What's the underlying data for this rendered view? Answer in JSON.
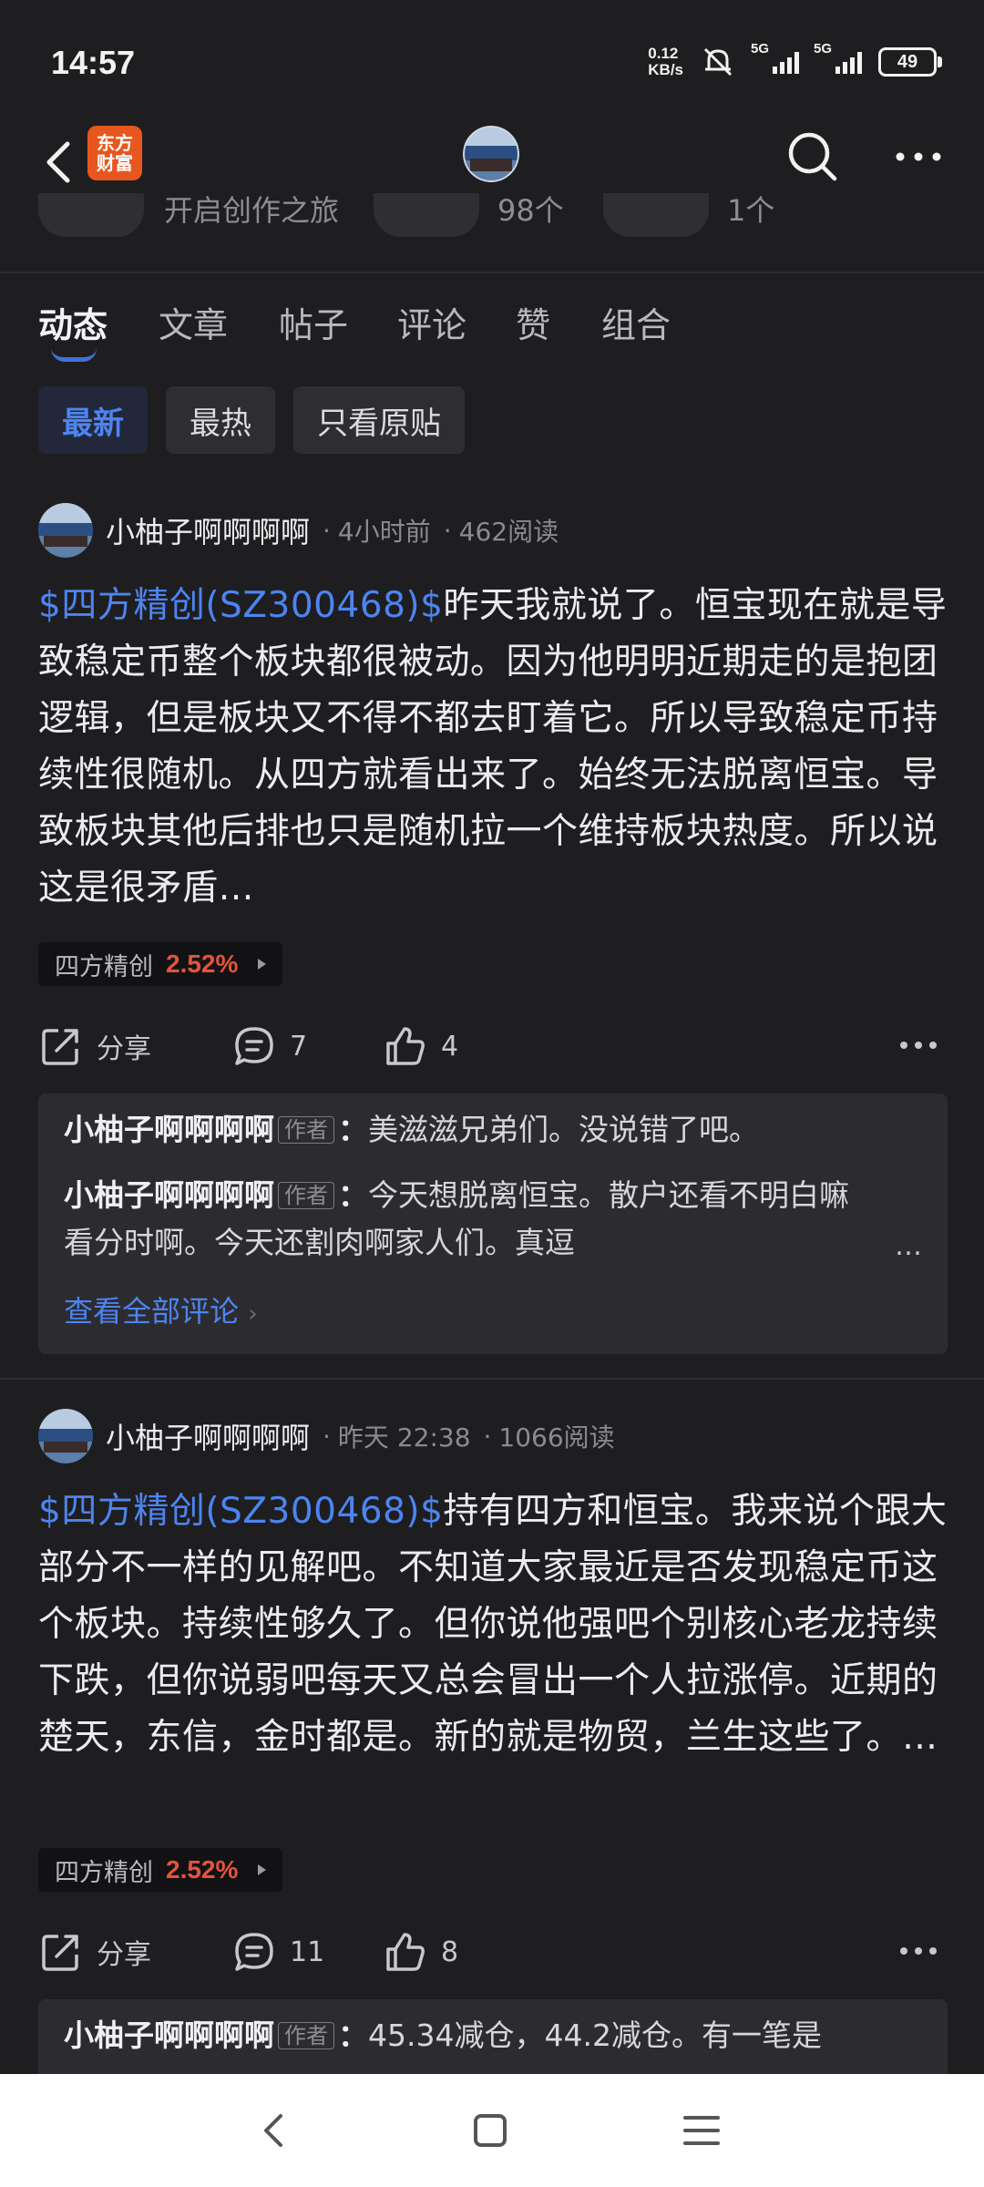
{
  "status_bar": {
    "time": "14:57",
    "net_speed_value": "0.12",
    "net_speed_unit": "KB/s",
    "sim1": "5G",
    "sim2": "5G",
    "battery": "49"
  },
  "header": {
    "logo_line1": "东方",
    "logo_line2": "财富"
  },
  "profile_stats": {
    "item1": "开启创作之旅",
    "item2": "98个",
    "item3": "1个"
  },
  "tabs": [
    "动态",
    "文章",
    "帖子",
    "评论",
    "赞",
    "组合"
  ],
  "filters": [
    "最新",
    "最热",
    "只看原贴"
  ],
  "posts": [
    {
      "author": "小柚子啊啊啊啊",
      "time": "4小时前",
      "reads": "462阅读",
      "stock_link": "$四方精创(SZ300468)$",
      "text": "昨天我就说了。恒宝现在就是导致稳定币整个板块都很被动。因为他明明近期走的是抱团逻辑，但是板块又不得不都去盯着它。所以导致稳定币持续性很随机。从四方就看出来了。始终无法脱离恒宝。导致板块其他后排也只是随机拉一个维持板块热度。所以说这是很矛盾…",
      "tag_name": "四方精创",
      "tag_pct": "2.52%",
      "share": "分享",
      "comment_count": "7",
      "like_count": "4",
      "comments": [
        {
          "author": "小柚子啊啊啊啊",
          "badge": "作者",
          "sep": "：",
          "text": "美滋滋兄弟们。没说错了吧。"
        },
        {
          "author": "小柚子啊啊啊啊",
          "badge": "作者",
          "sep": "：",
          "text": "今天想脱离恒宝。散户还看不明白嘛看分时啊。今天还割肉啊家人们。真逗"
        }
      ],
      "view_all": "查看全部评论"
    },
    {
      "author": "小柚子啊啊啊啊",
      "time": "昨天 22:38",
      "reads": "1066阅读",
      "stock_link": "$四方精创(SZ300468)$",
      "text": "持有四方和恒宝。我来说个跟大部分不一样的见解吧。不知道大家最近是否发现稳定币这个板块。持续性够久了。但你说他强吧个别核心老龙持续下跌，但你说弱吧每天又总会冒出一个人拉涨停。近期的楚天，东信，金时都是。新的就是物贸，兰生这些了。…",
      "tag_name": "四方精创",
      "tag_pct": "2.52%",
      "share": "分享",
      "comment_count": "11",
      "like_count": "8",
      "comments": [
        {
          "author": "小柚子啊啊啊啊",
          "badge": "作者",
          "sep": "：",
          "text": "45.34减仓，44.2减仓。有一笔是"
        }
      ]
    }
  ],
  "colors": {
    "background": "#1e1e20",
    "accent_blue": "#4d84f0",
    "rise_red": "#e5533d",
    "logo_orange": "#e8561f"
  }
}
